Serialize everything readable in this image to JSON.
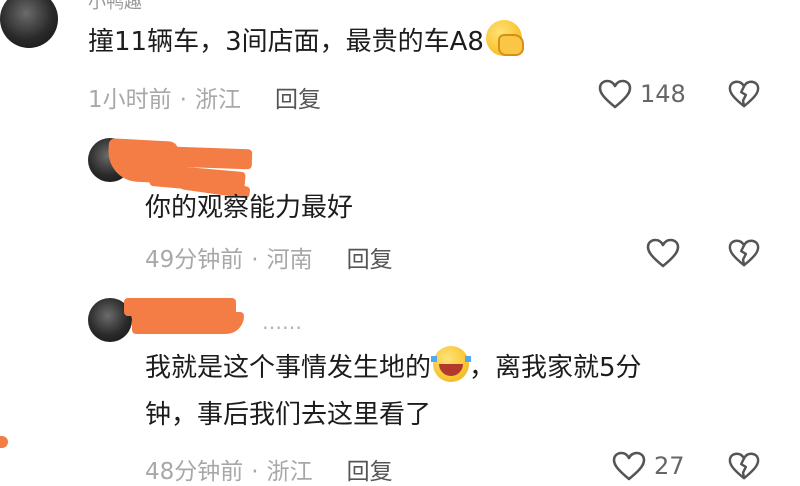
{
  "comments": [
    {
      "username": "小鸭趣",
      "text": "撞11辆车，3间店面，最贵的车A8",
      "emoji": "facepalm-emoji",
      "time": "1小时前",
      "location": "浙江",
      "reply_label": "回复",
      "likes": "148"
    },
    {
      "username": "",
      "text": "你的观察能力最好",
      "time": "49分钟前",
      "location": "河南",
      "reply_label": "回复",
      "likes": ""
    },
    {
      "username": "",
      "ellipsis": "……",
      "text_line1": "我就是这个事情发生地的",
      "emoji": "laughing-crying-emoji",
      "text_line1_after": "，离我家就5分",
      "text_line2": "钟，事后我们去这里看了",
      "time": "48分钟前",
      "location": "浙江",
      "reply_label": "回复",
      "likes": "27"
    }
  ],
  "separator": "·",
  "colors": {
    "redaction": "#f47c45",
    "meta": "#a8a8a8",
    "text": "#1c1c1c"
  }
}
